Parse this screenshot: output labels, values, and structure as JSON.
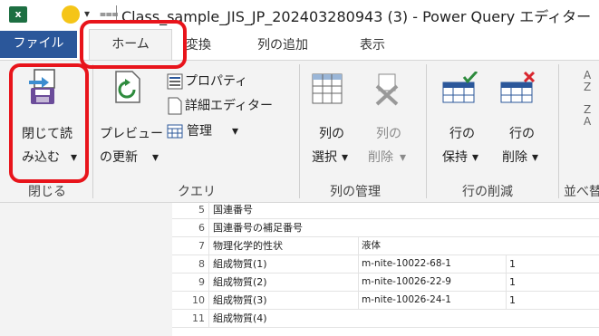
{
  "titlebar": {
    "app_icon": "excel-icon",
    "app_icon_letter": "x",
    "emoji_icon": "smiley-icon",
    "title": "Class_sample_JIS_JP_202403280943 (3) - Power Query エディター"
  },
  "tabs": {
    "file": "ファイル",
    "home": "ホーム",
    "transform": "変換",
    "add_column": "列の追加",
    "view": "表示"
  },
  "ribbon": {
    "close": {
      "close_load_line1": "閉じて読",
      "close_load_line2": "み込む",
      "caret": "▾",
      "group_label": "閉じる"
    },
    "query": {
      "refresh_line1": "プレビュー",
      "refresh_line2": "の更新",
      "properties": "プロパティ",
      "advanced_editor": "詳細エディター",
      "manage": "管理",
      "group_label": "クエリ"
    },
    "manage_columns": {
      "choose_line1": "列の",
      "choose_line2": "選択",
      "remove_line1": "列の",
      "remove_line2": "削除",
      "group_label": "列の管理"
    },
    "reduce_rows": {
      "keep_line1": "行の",
      "keep_line2": "保持",
      "remove_line1": "行の",
      "remove_line2": "削除",
      "group_label": "行の削減"
    },
    "sort": {
      "group_label": "並べ替"
    }
  },
  "grid": {
    "rows": [
      {
        "num": "5",
        "name": "国連番号",
        "value": "",
        "extra": ""
      },
      {
        "num": "6",
        "name": "国連番号の補足番号",
        "value": "",
        "extra": ""
      },
      {
        "num": "7",
        "name": "物理化学的性状",
        "value": "液体",
        "extra": ""
      },
      {
        "num": "8",
        "name": "組成物質(1)",
        "value": "m-nite-10022-68-1",
        "extra": "1"
      },
      {
        "num": "9",
        "name": "組成物質(2)",
        "value": "m-nite-10026-22-9",
        "extra": "1"
      },
      {
        "num": "10",
        "name": "組成物質(3)",
        "value": "m-nite-10026-24-1",
        "extra": "1"
      },
      {
        "num": "11",
        "name": "組成物質(4)",
        "value": "",
        "extra": ""
      }
    ]
  },
  "colors": {
    "file_tab": "#2b579a",
    "highlight": "#e8141b",
    "ribbon_bg": "#f3f3f3"
  }
}
